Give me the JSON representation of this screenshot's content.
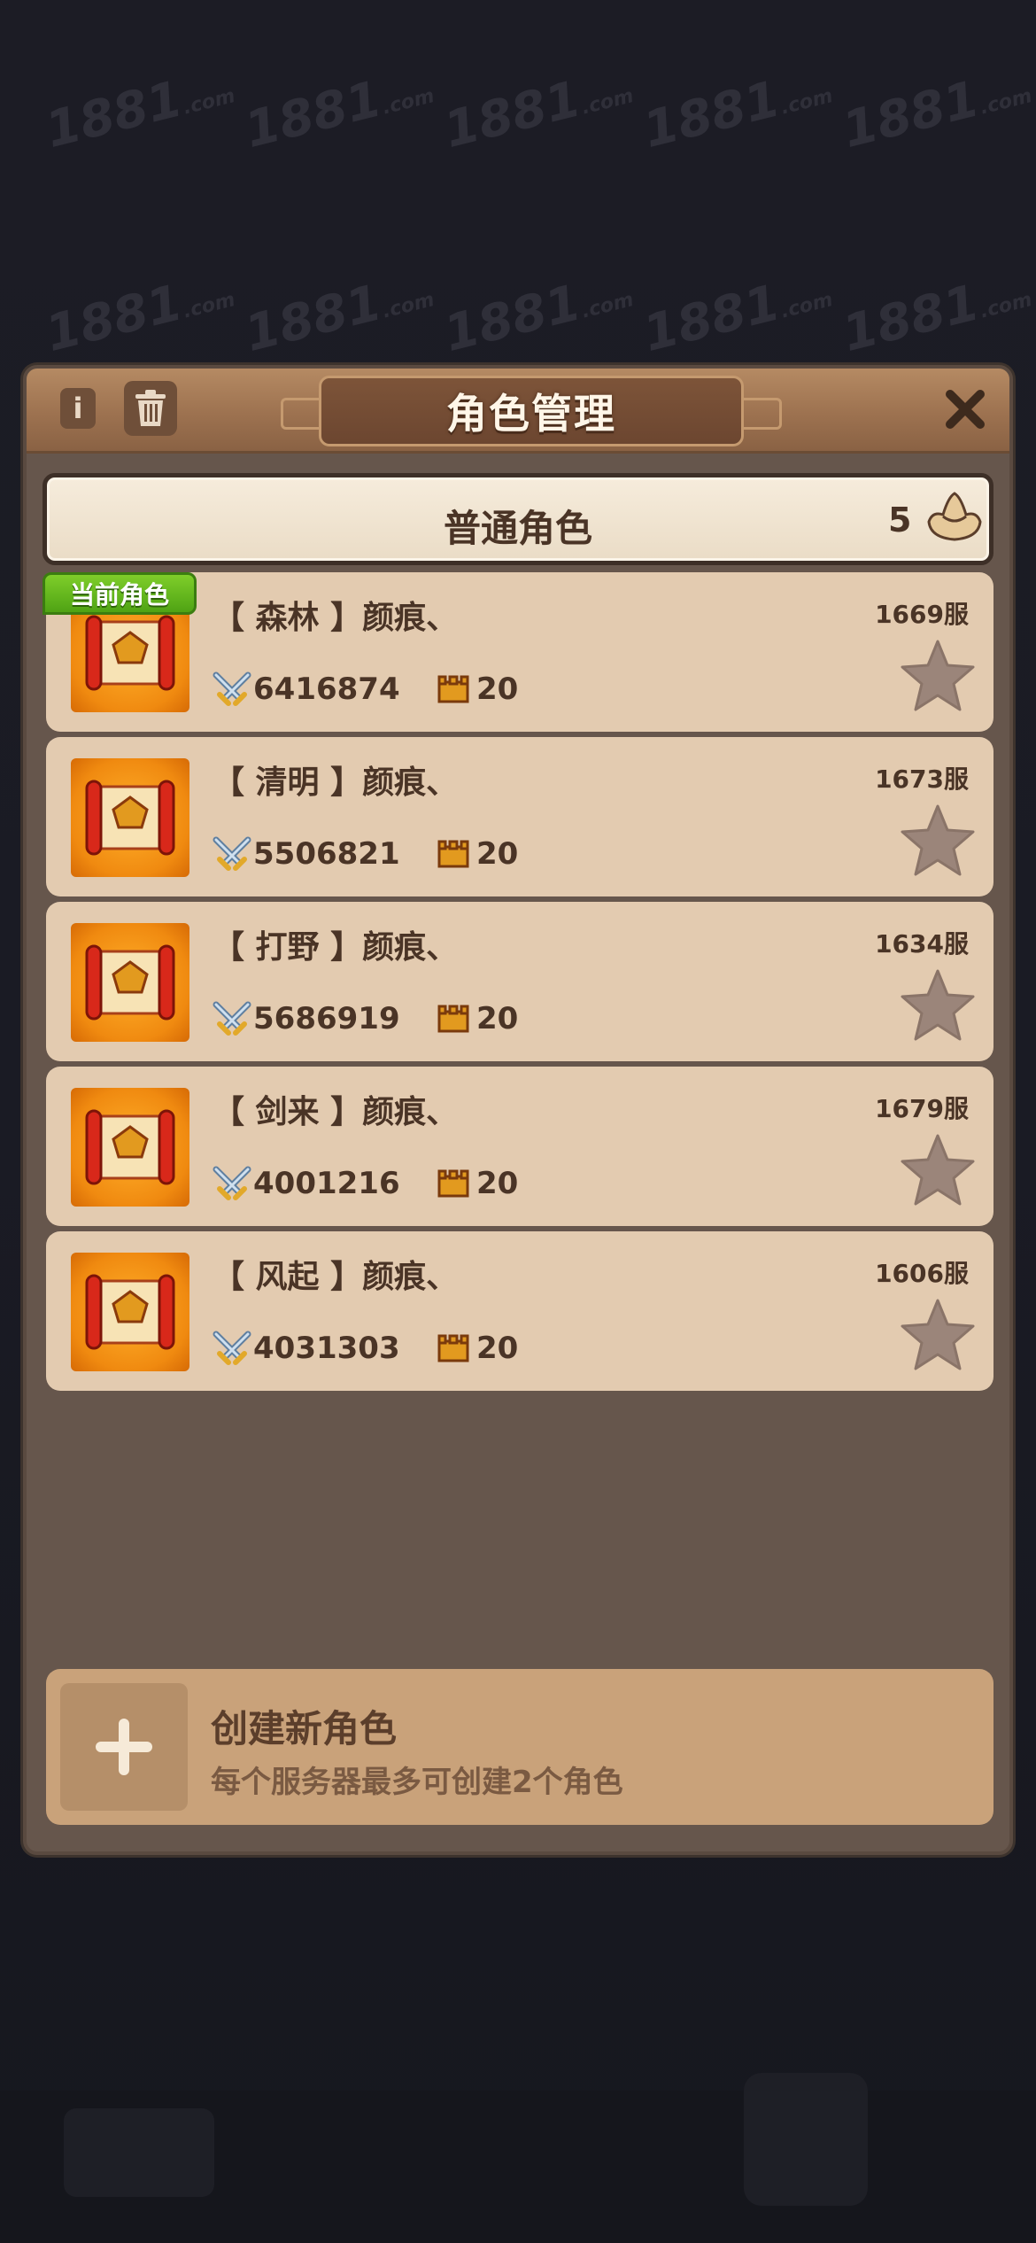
{
  "header": {
    "title": "角色管理",
    "info_label": "i"
  },
  "category": {
    "label": "普通角色",
    "count": "5"
  },
  "current_badge": "当前角色",
  "roles": [
    {
      "name": "【 森林 】颜痕、",
      "server": "1669服",
      "power": "6416874",
      "level": "20",
      "current": true
    },
    {
      "name": "【 清明 】颜痕、",
      "server": "1673服",
      "power": "5506821",
      "level": "20",
      "current": false
    },
    {
      "name": "【 打野 】颜痕、",
      "server": "1634服",
      "power": "5686919",
      "level": "20",
      "current": false
    },
    {
      "name": "【 剑来 】颜痕、",
      "server": "1679服",
      "power": "4001216",
      "level": "20",
      "current": false
    },
    {
      "name": "【 风起 】颜痕、",
      "server": "1606服",
      "power": "4031303",
      "level": "20",
      "current": false
    }
  ],
  "create": {
    "title": "创建新角色",
    "subtitle": "每个服务器最多可创建2个角色"
  },
  "watermark": {
    "text": "1881",
    "suffix": ".com"
  },
  "colors": {
    "panel": "#66564c",
    "card": "#e3cbb0",
    "text": "#4a3426",
    "badge": "#5fb31a"
  },
  "icons": [
    "info-icon",
    "trash-icon",
    "close-icon",
    "gold-ingot-icon",
    "crossed-swords-icon",
    "tower-icon",
    "star-icon",
    "plus-icon"
  ]
}
